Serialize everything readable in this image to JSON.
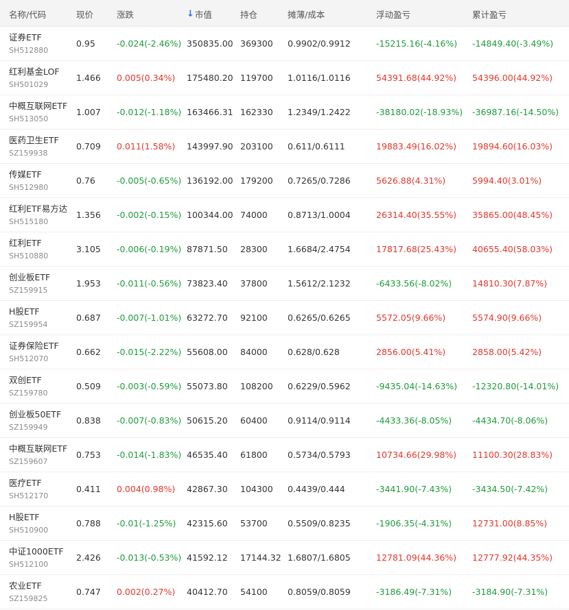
{
  "header": {
    "name_code": "名称/代码",
    "price": "现价",
    "change": "涨跌",
    "sort_arrow": "↓",
    "market_value": "市值",
    "position": "持仓",
    "cost": "摊薄/成本",
    "floating_pl": "浮动盈亏",
    "cumulative_pl": "累计盈亏"
  },
  "colors": {
    "up": "#e0372c",
    "down": "#1e9a3c",
    "sort_accent": "#2b73d9"
  },
  "rows": [
    {
      "name": "证券ETF",
      "code": "SH512880",
      "price": "0.95",
      "change": "-0.024(-2.46%)",
      "mv": "350835.00",
      "pos": "369300",
      "cost": "0.9902/0.9912",
      "float": "-15215.16(-4.16%)",
      "cum": "-14849.40(-3.49%)"
    },
    {
      "name": "红利基金LOF",
      "code": "SH501029",
      "price": "1.466",
      "change": "0.005(0.34%)",
      "mv": "175480.20",
      "pos": "119700",
      "cost": "1.0116/1.0116",
      "float": "54391.68(44.92%)",
      "cum": "54396.00(44.92%)"
    },
    {
      "name": "中概互联网ETF",
      "code": "SH513050",
      "price": "1.007",
      "change": "-0.012(-1.18%)",
      "mv": "163466.31",
      "pos": "162330",
      "cost": "1.2349/1.2422",
      "float": "-38180.02(-18.93%)",
      "cum": "-36987.16(-14.50%)"
    },
    {
      "name": "医药卫生ETF",
      "code": "SZ159938",
      "price": "0.709",
      "change": "0.011(1.58%)",
      "mv": "143997.90",
      "pos": "203100",
      "cost": "0.611/0.6111",
      "float": "19883.49(16.02%)",
      "cum": "19894.60(16.03%)"
    },
    {
      "name": "传媒ETF",
      "code": "SH512980",
      "price": "0.76",
      "change": "-0.005(-0.65%)",
      "mv": "136192.00",
      "pos": "179200",
      "cost": "0.7265/0.7286",
      "float": "5626.88(4.31%)",
      "cum": "5994.40(3.01%)"
    },
    {
      "name": "红利ETF易方达",
      "code": "SH515180",
      "price": "1.356",
      "change": "-0.002(-0.15%)",
      "mv": "100344.00",
      "pos": "74000",
      "cost": "0.8713/1.0004",
      "float": "26314.40(35.55%)",
      "cum": "35865.00(48.45%)"
    },
    {
      "name": "红利ETF",
      "code": "SH510880",
      "price": "3.105",
      "change": "-0.006(-0.19%)",
      "mv": "87871.50",
      "pos": "28300",
      "cost": "1.6684/2.4754",
      "float": "17817.68(25.43%)",
      "cum": "40655.40(58.03%)"
    },
    {
      "name": "创业板ETF",
      "code": "SZ159915",
      "price": "1.953",
      "change": "-0.011(-0.56%)",
      "mv": "73823.40",
      "pos": "37800",
      "cost": "1.5612/2.1232",
      "float": "-6433.56(-8.02%)",
      "cum": "14810.30(7.87%)"
    },
    {
      "name": "H股ETF",
      "code": "SZ159954",
      "price": "0.687",
      "change": "-0.007(-1.01%)",
      "mv": "63272.70",
      "pos": "92100",
      "cost": "0.6265/0.6265",
      "float": "5572.05(9.66%)",
      "cum": "5574.90(9.66%)"
    },
    {
      "name": "证券保险ETF",
      "code": "SH512070",
      "price": "0.662",
      "change": "-0.015(-2.22%)",
      "mv": "55608.00",
      "pos": "84000",
      "cost": "0.628/0.628",
      "float": "2856.00(5.41%)",
      "cum": "2858.00(5.42%)"
    },
    {
      "name": "双创ETF",
      "code": "SZ159780",
      "price": "0.509",
      "change": "-0.003(-0.59%)",
      "mv": "55073.80",
      "pos": "108200",
      "cost": "0.6229/0.5962",
      "float": "-9435.04(-14.63%)",
      "cum": "-12320.80(-14.01%)"
    },
    {
      "name": "创业板50ETF",
      "code": "SZ159949",
      "price": "0.838",
      "change": "-0.007(-0.83%)",
      "mv": "50615.20",
      "pos": "60400",
      "cost": "0.9114/0.9114",
      "float": "-4433.36(-8.05%)",
      "cum": "-4434.70(-8.06%)"
    },
    {
      "name": "中概互联网ETF",
      "code": "SZ159607",
      "price": "0.753",
      "change": "-0.014(-1.83%)",
      "mv": "46535.40",
      "pos": "61800",
      "cost": "0.5734/0.5793",
      "float": "10734.66(29.98%)",
      "cum": "11100.30(28.83%)"
    },
    {
      "name": "医疗ETF",
      "code": "SH512170",
      "price": "0.411",
      "change": "0.004(0.98%)",
      "mv": "42867.30",
      "pos": "104300",
      "cost": "0.4439/0.444",
      "float": "-3441.90(-7.43%)",
      "cum": "-3434.50(-7.42%)"
    },
    {
      "name": "H股ETF",
      "code": "SH510900",
      "price": "0.788",
      "change": "-0.01(-1.25%)",
      "mv": "42315.60",
      "pos": "53700",
      "cost": "0.5509/0.8235",
      "float": "-1906.35(-4.31%)",
      "cum": "12731.00(8.85%)"
    },
    {
      "name": "中证1000ETF",
      "code": "SH512100",
      "price": "2.426",
      "change": "-0.013(-0.53%)",
      "mv": "41592.12",
      "pos": "17144.32",
      "cost": "1.6807/1.6805",
      "float": "12781.09(44.36%)",
      "cum": "12777.92(44.35%)"
    },
    {
      "name": "农业ETF",
      "code": "SZ159825",
      "price": "0.747",
      "change": "0.002(0.27%)",
      "mv": "40412.70",
      "pos": "54100",
      "cost": "0.8059/0.8059",
      "float": "-3186.49(-7.31%)",
      "cum": "-3184.90(-7.31%)"
    }
  ]
}
